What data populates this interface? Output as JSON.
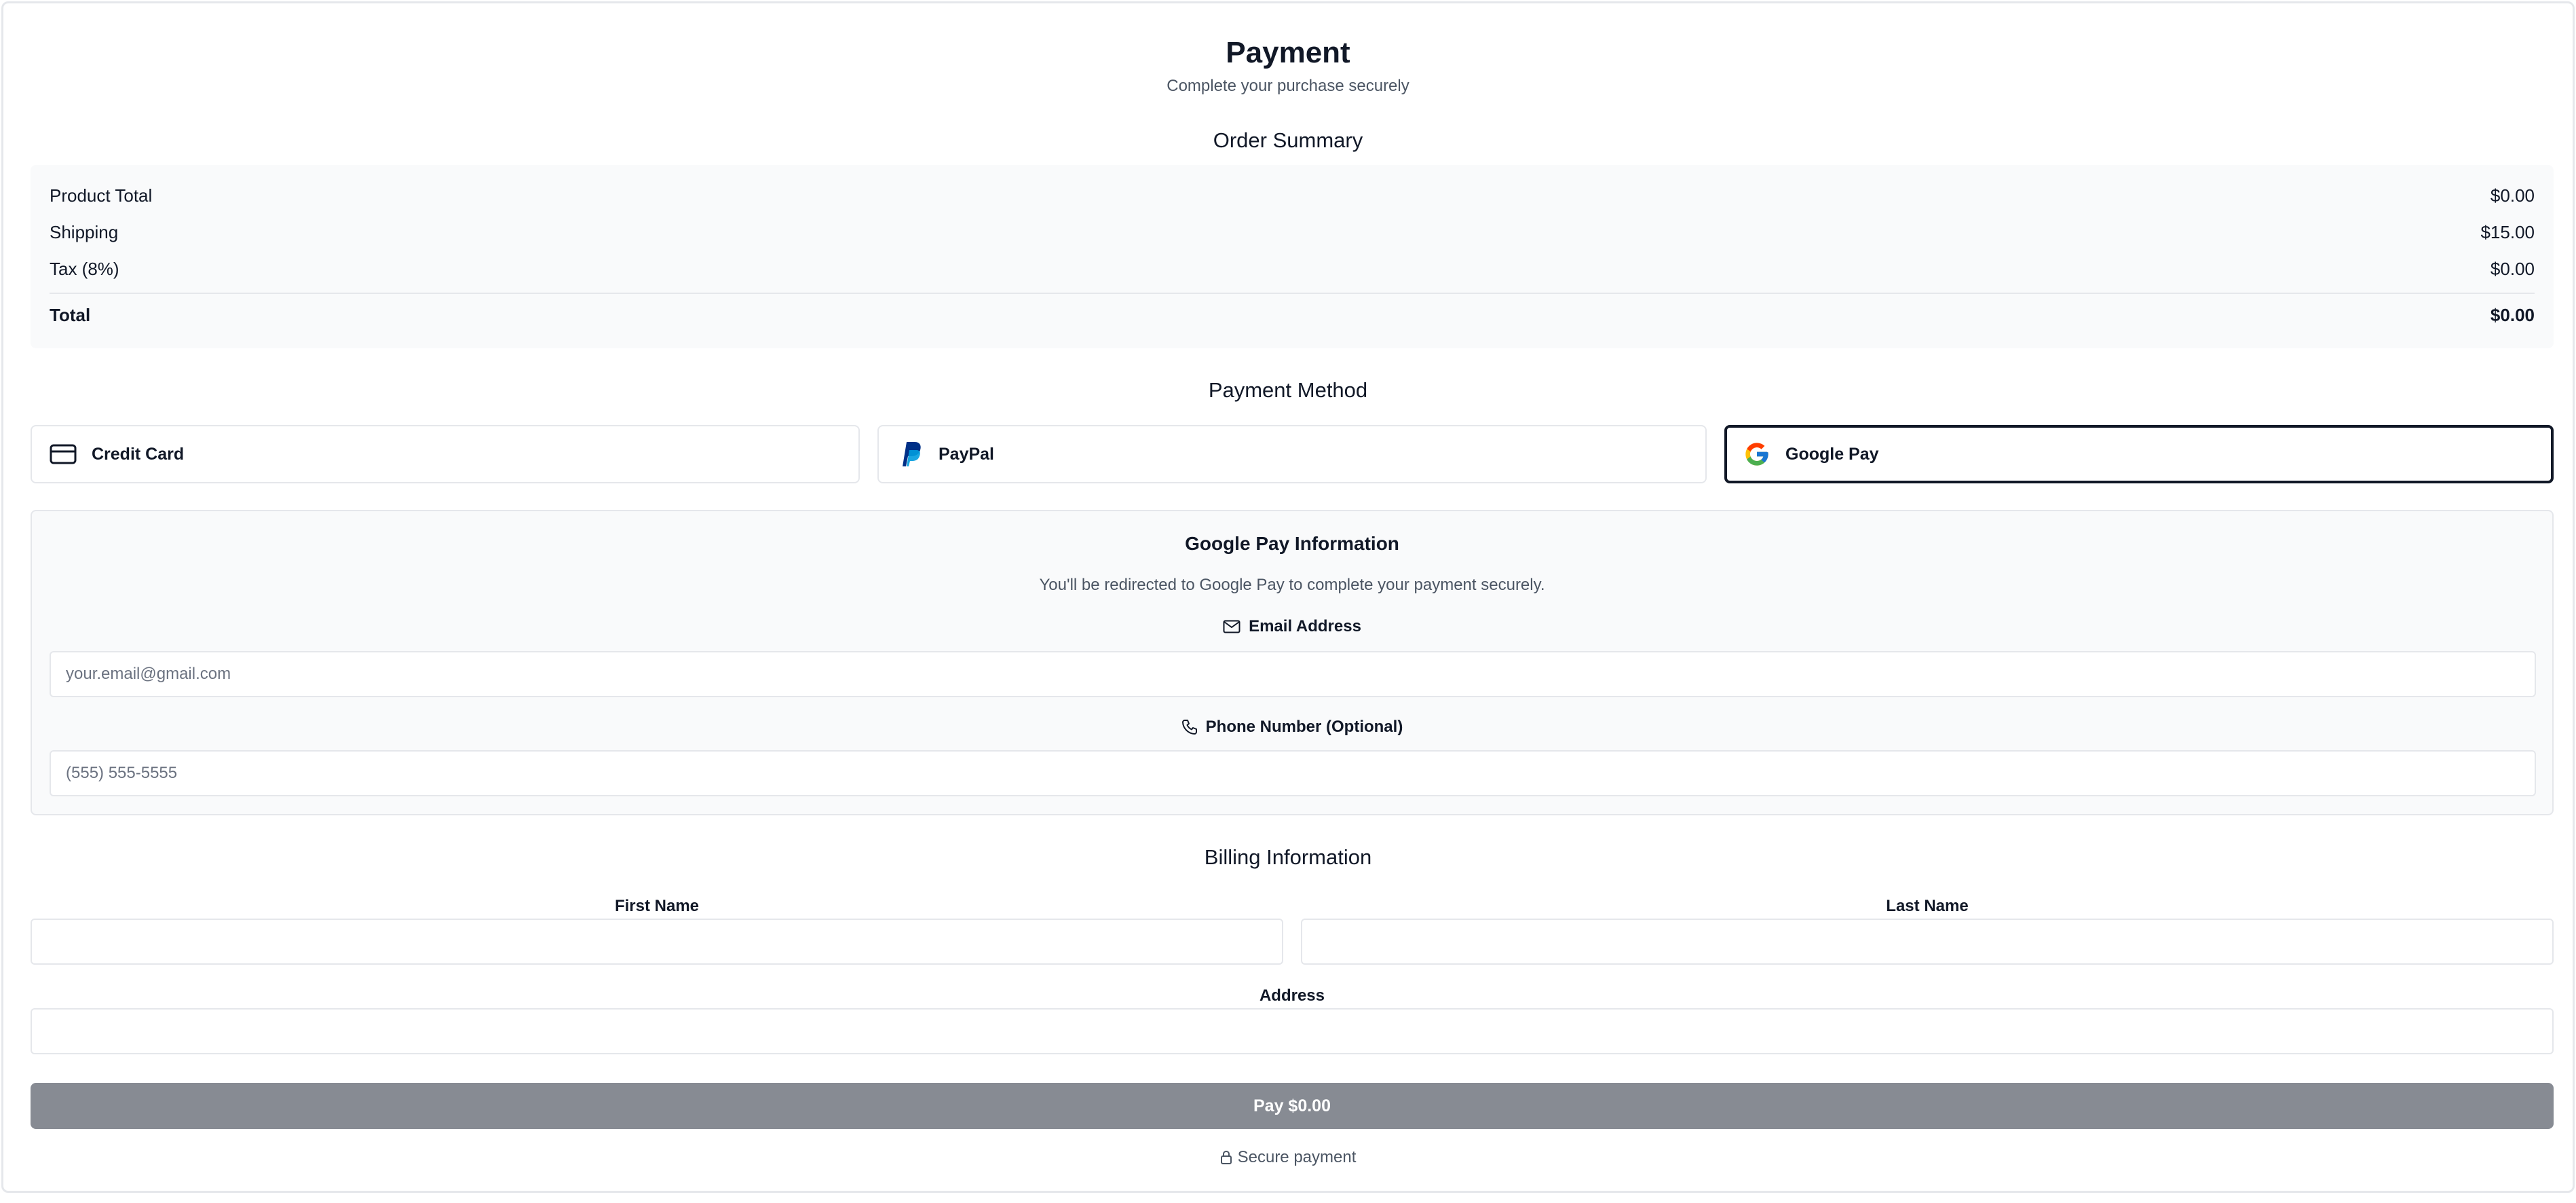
{
  "header": {
    "title": "Payment",
    "subtitle": "Complete your purchase securely"
  },
  "order_summary": {
    "title": "Order Summary",
    "rows": [
      {
        "label": "Product Total",
        "value": "$0.00"
      },
      {
        "label": "Shipping",
        "value": "$15.00"
      },
      {
        "label": "Tax (8%)",
        "value": "$0.00"
      }
    ],
    "total": {
      "label": "Total",
      "value": "$0.00"
    }
  },
  "payment_method": {
    "title": "Payment Method",
    "options": [
      {
        "label": "Credit Card",
        "icon": "credit-card-icon",
        "selected": false
      },
      {
        "label": "PayPal",
        "icon": "paypal-icon",
        "selected": false
      },
      {
        "label": "Google Pay",
        "icon": "google-icon",
        "selected": true
      }
    ]
  },
  "google_pay": {
    "title": "Google Pay Information",
    "description": "You'll be redirected to Google Pay to complete your payment securely.",
    "email_label": "Email Address",
    "email_placeholder": "your.email@gmail.com",
    "email_value": "",
    "phone_label": "Phone Number (Optional)",
    "phone_placeholder": "(555) 555-5555",
    "phone_value": ""
  },
  "billing": {
    "title": "Billing Information",
    "first_name_label": "First Name",
    "first_name_value": "",
    "last_name_label": "Last Name",
    "last_name_value": "",
    "address_label": "Address",
    "address_value": ""
  },
  "pay_button_label": "Pay $0.00",
  "secure_label": "Secure payment",
  "colors": {
    "pay_button_bg": "#878b93",
    "selected_border": "#111827",
    "panel_bg": "#f9fafb",
    "paypal_dark": "#003087",
    "paypal_light": "#009cde"
  }
}
